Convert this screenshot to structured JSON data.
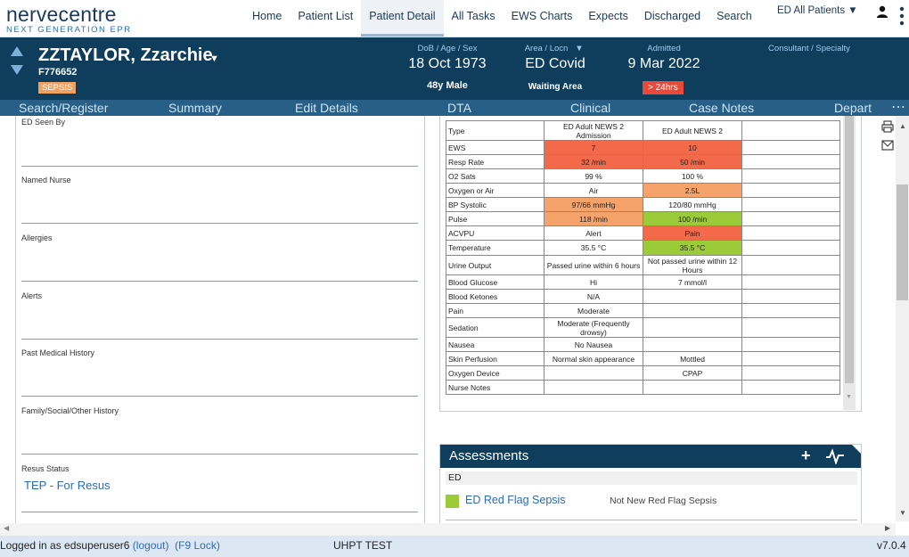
{
  "logo": {
    "main": "nervecentre",
    "sub": "NEXT GENERATION EPR"
  },
  "nav": {
    "items": [
      "Home",
      "Patient List",
      "Patient Detail",
      "All Tasks",
      "EWS Charts",
      "Expects",
      "Discharged",
      "Search"
    ],
    "active": "Patient Detail",
    "filter": "ED All Patients ▼"
  },
  "patient": {
    "name": "ZZTAYLOR, Zzarchie",
    "id": "F776652",
    "badge": "SEPSIS",
    "dob_header": "DoB / Age / Sex",
    "dob": "18 Oct 1973",
    "age_sex": "48y Male",
    "area_header": "Area / Locn",
    "area": "ED Covid",
    "area_sub": "Waiting Area",
    "admitted_header": "Admitted",
    "admitted": "9 Mar 2022",
    "admitted_badge": "> 24hrs",
    "consultant_header": "Consultant / Specialty"
  },
  "actions": [
    "Search/Register",
    "Summary",
    "Edit Details",
    "DTA",
    "Clinical",
    "Case Notes",
    "Depart"
  ],
  "form": {
    "fields": [
      {
        "label": "ED Seen By",
        "value": ""
      },
      {
        "label": "Named Nurse",
        "value": ""
      },
      {
        "label": "Allergies",
        "value": ""
      },
      {
        "label": "Alerts",
        "value": ""
      },
      {
        "label": "Past Medical History",
        "value": ""
      },
      {
        "label": "Family/Social/Other History",
        "value": ""
      },
      {
        "label": "Resus Status",
        "value": "TEP - For Resus"
      }
    ]
  },
  "news": {
    "rows": [
      {
        "label": "Type",
        "c1": "ED Adult NEWS 2 Admission",
        "c2": "ED Adult NEWS 2",
        "s1": "",
        "s2": ""
      },
      {
        "label": "EWS",
        "c1": "7",
        "c2": "10",
        "s1": "red",
        "s2": "red"
      },
      {
        "label": "Resp Rate",
        "c1": "32 /min",
        "c2": "50 /min",
        "s1": "red",
        "s2": "red"
      },
      {
        "label": "O2 Sats",
        "c1": "99 %",
        "c2": "100 %",
        "s1": "",
        "s2": ""
      },
      {
        "label": "Oxygen or Air",
        "c1": "Air",
        "c2": "2.5L",
        "s1": "",
        "s2": "orange"
      },
      {
        "label": "BP Systolic",
        "c1": "97/66 mmHg",
        "c2": "120/80 mmHg",
        "s1": "orange",
        "s2": ""
      },
      {
        "label": "Pulse",
        "c1": "118 /min",
        "c2": "100 /min",
        "s1": "orange",
        "s2": "green"
      },
      {
        "label": "ACVPU",
        "c1": "Alert",
        "c2": "Pain",
        "s1": "",
        "s2": "red"
      },
      {
        "label": "Temperature",
        "c1": "35.5 °C",
        "c2": "35.5 °C",
        "s1": "",
        "s2": "green"
      },
      {
        "label": "Urine Output",
        "c1": "Passed urine within 6 hours",
        "c2": "Not passed urine within 12 Hours",
        "s1": "",
        "s2": ""
      },
      {
        "label": "Blood Glucose",
        "c1": "Hi",
        "c2": "7 mmol/l",
        "s1": "",
        "s2": ""
      },
      {
        "label": "Blood Ketones",
        "c1": "N/A",
        "c2": "",
        "s1": "",
        "s2": ""
      },
      {
        "label": "Pain",
        "c1": "Moderate",
        "c2": "",
        "s1": "",
        "s2": ""
      },
      {
        "label": "Sedation",
        "c1": "Moderate (Frequently drowsy)",
        "c2": "",
        "s1": "",
        "s2": ""
      },
      {
        "label": "Nausea",
        "c1": "No Nausea",
        "c2": "",
        "s1": "",
        "s2": ""
      },
      {
        "label": "Skin Perfusion",
        "c1": "Normal skin appearance",
        "c2": "Mottled",
        "s1": "",
        "s2": ""
      },
      {
        "label": "Oxygen Device",
        "c1": "",
        "c2": "CPAP",
        "s1": "",
        "s2": ""
      },
      {
        "label": "Nurse Notes",
        "c1": "",
        "c2": "",
        "s1": "",
        "s2": ""
      }
    ]
  },
  "assessments": {
    "title": "Assessments",
    "plus": "+",
    "section": "ED",
    "item_link": "ED Red Flag Sepsis",
    "item_status": "Not New Red Flag Sepsis",
    "status_color": "#9ccb3a"
  },
  "statusbar": {
    "logged_in": "Logged in as edsuperuser6",
    "logout": "(logout)",
    "lock": "(F9 Lock)",
    "env": "UHPT TEST",
    "version": "v7.0.4"
  }
}
